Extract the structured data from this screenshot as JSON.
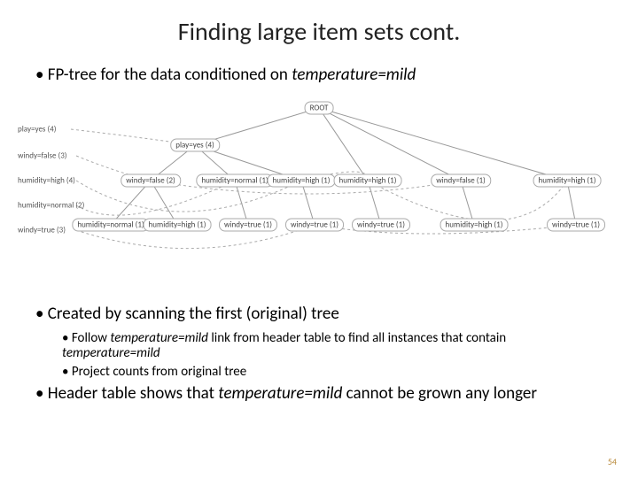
{
  "title": "Finding large item sets cont.",
  "bullet_top": {
    "prefix": "FP-tree for the data conditioned on ",
    "em": "temperature=mild"
  },
  "headers": {
    "h0": "play=yes (4)",
    "h1": "windy=false (3)",
    "h2": "humidity=high (4)",
    "h3": "humidity=normal (2)",
    "h4": "windy=true (3)"
  },
  "nodes": {
    "root": "ROOT",
    "n_playyes": "play=yes (4)",
    "n_play_wf": "windy=false (2)",
    "n_play_hn1": "humidity=normal (1)",
    "n_play_hh1": "humidity=high (1)",
    "n_play_hn_leaf": "humidity=normal (1)",
    "n_play_hh_leaf": "humidity=high (1)",
    "n_play_hn_wt": "windy=true (1)",
    "n_play_hh_wt": "windy=true (1)",
    "n_root_hh": "humidity=high (1)",
    "n_root_hh_wt": "windy=true (1)",
    "n_root_wf": "windy=false (1)",
    "n_root_wf_hh": "humidity=high (1)",
    "n_root_hh2": "humidity=high (1)",
    "n_root_hh2_wt": "windy=true (1)"
  },
  "bottom": {
    "b1": "Created by scanning the first (original) tree",
    "b2a_pre": "Follow ",
    "b2a_em": "temperature=mild",
    "b2a_mid": " link from header table to find all instances that contain ",
    "b2a_em2": "temperature=mild",
    "b2b": "Project counts from original tree",
    "b3_pre": "Header table shows that ",
    "b3_em": "temperature=mild",
    "b3_post": " cannot be grown any longer"
  },
  "pagenum": "54"
}
